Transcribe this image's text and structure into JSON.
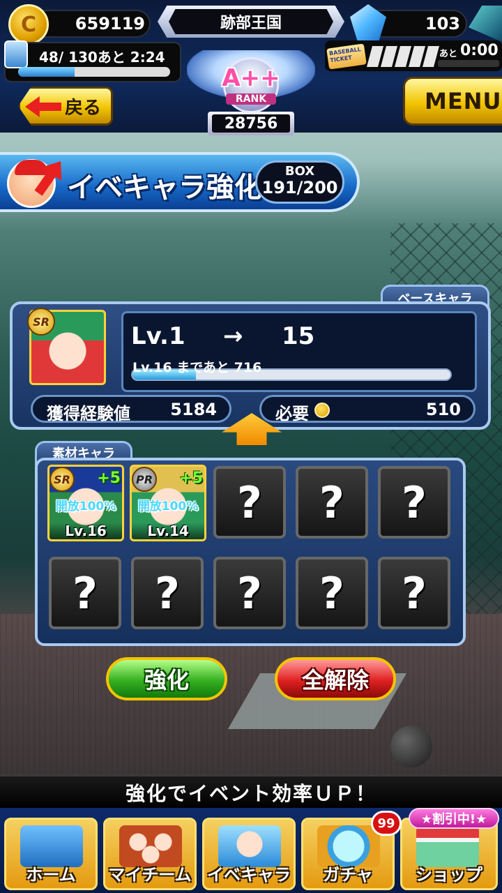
{
  "header": {
    "coins": "659119",
    "coin_symbol": "C",
    "kingdom_name": "跡部王国",
    "gems": "103",
    "stamina_text": "48/ 130あと  2:24",
    "stamina_fraction": 0.37,
    "ticket_label": "BASEBALL TICKET",
    "ticket_ato": "あと",
    "ticket_time": "0:00",
    "rank": "A++",
    "rank_label": "RANK",
    "rank_score": "28756",
    "back_label": "戻る",
    "menu_label": "MENU"
  },
  "title": {
    "text": "イベキャラ強化",
    "box_label": "BOX",
    "box_value": "191/200"
  },
  "base": {
    "tab_label": "ベースキャラ",
    "rarity": "SR",
    "level_from": "Lv.1",
    "arrow": "→",
    "level_to": "15",
    "next_level_text": "Lv.16  まであと 716",
    "next_level_fraction": 0.2,
    "exp_label": "獲得経験値",
    "exp_value": "5184",
    "need_label": "必要",
    "need_value": "510"
  },
  "materials": {
    "tab_label": "素材キャラ",
    "characters": [
      {
        "rarity": "SR",
        "plus": "+5",
        "release": "開放100%",
        "level": "Lv.16"
      },
      {
        "rarity": "PR",
        "plus": "+5",
        "release": "開放100%",
        "level": "Lv.14"
      }
    ],
    "empty_mark": "?"
  },
  "actions": {
    "enhance_label": "強化",
    "clear_label": "全解除"
  },
  "tip": "強化でイベント効率ＵＰ！",
  "nav": {
    "items": [
      {
        "label": "ホーム"
      },
      {
        "label": "マイチーム"
      },
      {
        "label": "イベキャラ"
      },
      {
        "label": "ガチャ"
      },
      {
        "label": "ショップ"
      }
    ],
    "gacha_badge": "99",
    "shop_tag": "★割引中!★"
  },
  "colors": {
    "accent_gold": "#f2c400",
    "panel_blue": "#183462",
    "enhance_green": "#35b020",
    "clear_red": "#e02020"
  }
}
